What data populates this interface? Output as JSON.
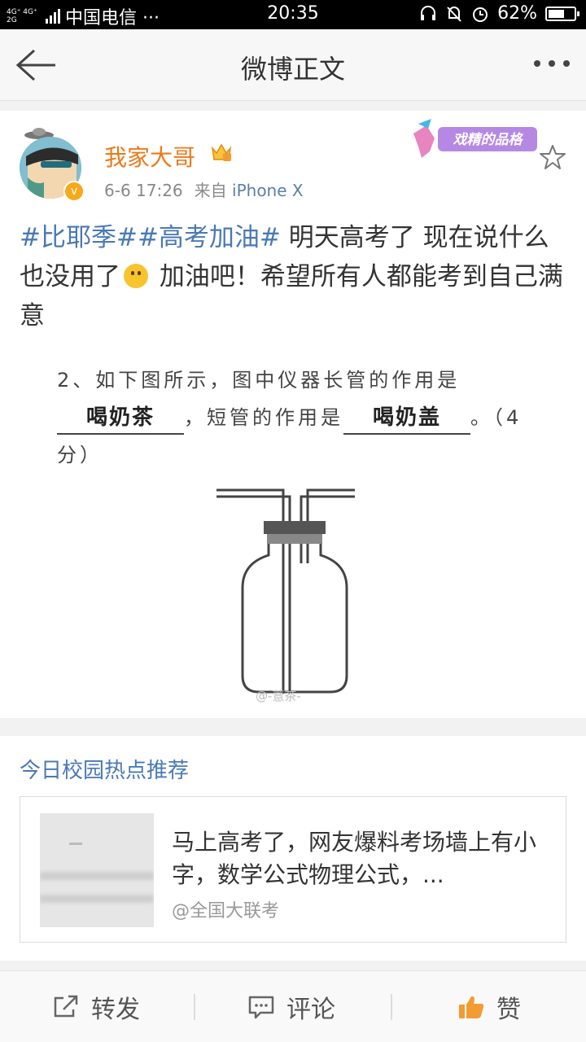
{
  "status_bar": {
    "network": "4G⁺ 4G⁺ 2G",
    "carrier": "中国电信 ···",
    "time": "20:35",
    "battery_percent": "62%",
    "battery_level": 0.62
  },
  "nav": {
    "title": "微博正文"
  },
  "post": {
    "username": "我家大哥",
    "date": "6-6 17:26",
    "source_prefix": "来自",
    "device": "iPhone X",
    "deco_badge_text": "戏精的品格",
    "text": {
      "tags": "#比耶季##高考加油#",
      "body1": " 明天高考了 现在说什么也没用了",
      "body2": " 加油吧！希望所有人都能考到自己满意"
    },
    "image": {
      "question_line1": "2、如下图所示，图中仪器长管的作用是",
      "answer1": "喝奶茶",
      "question_mid": "，短管的作用是",
      "answer2": "喝奶盖",
      "question_end": "。（4分）",
      "watermark": "@-薏茶-"
    }
  },
  "recommend": {
    "section_title": "今日校园热点推荐",
    "headline": "马上高考了，网友爆料考场墙上有小字，数学公式物理公式，...",
    "source": "@全国大联考"
  },
  "actions": {
    "repost": "转发",
    "comment": "评论",
    "like": "赞"
  },
  "colors": {
    "link_blue": "#4a79b5",
    "username_orange": "#eb7a1a",
    "like_orange": "#f39c33"
  }
}
